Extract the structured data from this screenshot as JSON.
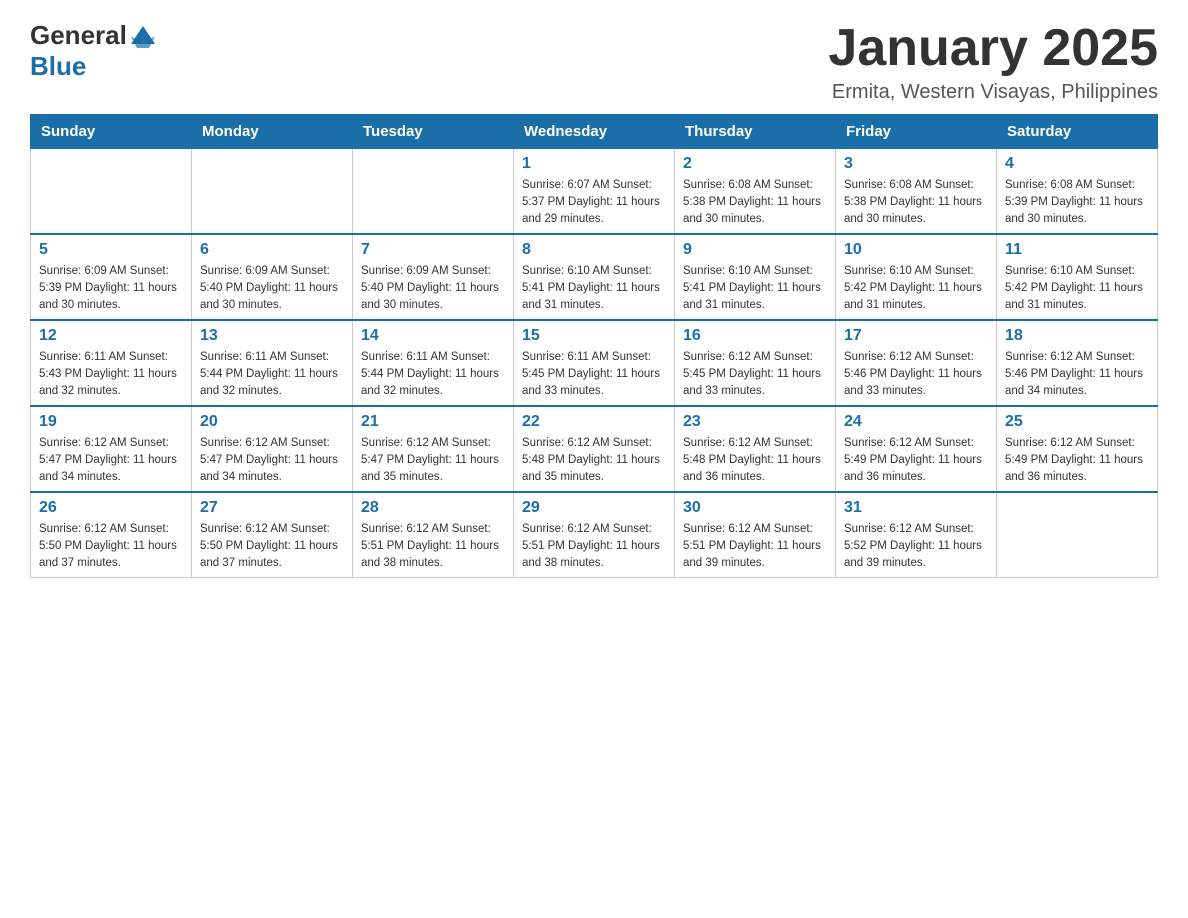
{
  "header": {
    "logo_general": "General",
    "logo_blue": "Blue",
    "month_title": "January 2025",
    "location": "Ermita, Western Visayas, Philippines"
  },
  "days_of_week": [
    "Sunday",
    "Monday",
    "Tuesday",
    "Wednesday",
    "Thursday",
    "Friday",
    "Saturday"
  ],
  "weeks": [
    [
      {
        "day": "",
        "info": ""
      },
      {
        "day": "",
        "info": ""
      },
      {
        "day": "",
        "info": ""
      },
      {
        "day": "1",
        "info": "Sunrise: 6:07 AM\nSunset: 5:37 PM\nDaylight: 11 hours and 29 minutes."
      },
      {
        "day": "2",
        "info": "Sunrise: 6:08 AM\nSunset: 5:38 PM\nDaylight: 11 hours and 30 minutes."
      },
      {
        "day": "3",
        "info": "Sunrise: 6:08 AM\nSunset: 5:38 PM\nDaylight: 11 hours and 30 minutes."
      },
      {
        "day": "4",
        "info": "Sunrise: 6:08 AM\nSunset: 5:39 PM\nDaylight: 11 hours and 30 minutes."
      }
    ],
    [
      {
        "day": "5",
        "info": "Sunrise: 6:09 AM\nSunset: 5:39 PM\nDaylight: 11 hours and 30 minutes."
      },
      {
        "day": "6",
        "info": "Sunrise: 6:09 AM\nSunset: 5:40 PM\nDaylight: 11 hours and 30 minutes."
      },
      {
        "day": "7",
        "info": "Sunrise: 6:09 AM\nSunset: 5:40 PM\nDaylight: 11 hours and 30 minutes."
      },
      {
        "day": "8",
        "info": "Sunrise: 6:10 AM\nSunset: 5:41 PM\nDaylight: 11 hours and 31 minutes."
      },
      {
        "day": "9",
        "info": "Sunrise: 6:10 AM\nSunset: 5:41 PM\nDaylight: 11 hours and 31 minutes."
      },
      {
        "day": "10",
        "info": "Sunrise: 6:10 AM\nSunset: 5:42 PM\nDaylight: 11 hours and 31 minutes."
      },
      {
        "day": "11",
        "info": "Sunrise: 6:10 AM\nSunset: 5:42 PM\nDaylight: 11 hours and 31 minutes."
      }
    ],
    [
      {
        "day": "12",
        "info": "Sunrise: 6:11 AM\nSunset: 5:43 PM\nDaylight: 11 hours and 32 minutes."
      },
      {
        "day": "13",
        "info": "Sunrise: 6:11 AM\nSunset: 5:44 PM\nDaylight: 11 hours and 32 minutes."
      },
      {
        "day": "14",
        "info": "Sunrise: 6:11 AM\nSunset: 5:44 PM\nDaylight: 11 hours and 32 minutes."
      },
      {
        "day": "15",
        "info": "Sunrise: 6:11 AM\nSunset: 5:45 PM\nDaylight: 11 hours and 33 minutes."
      },
      {
        "day": "16",
        "info": "Sunrise: 6:12 AM\nSunset: 5:45 PM\nDaylight: 11 hours and 33 minutes."
      },
      {
        "day": "17",
        "info": "Sunrise: 6:12 AM\nSunset: 5:46 PM\nDaylight: 11 hours and 33 minutes."
      },
      {
        "day": "18",
        "info": "Sunrise: 6:12 AM\nSunset: 5:46 PM\nDaylight: 11 hours and 34 minutes."
      }
    ],
    [
      {
        "day": "19",
        "info": "Sunrise: 6:12 AM\nSunset: 5:47 PM\nDaylight: 11 hours and 34 minutes."
      },
      {
        "day": "20",
        "info": "Sunrise: 6:12 AM\nSunset: 5:47 PM\nDaylight: 11 hours and 34 minutes."
      },
      {
        "day": "21",
        "info": "Sunrise: 6:12 AM\nSunset: 5:47 PM\nDaylight: 11 hours and 35 minutes."
      },
      {
        "day": "22",
        "info": "Sunrise: 6:12 AM\nSunset: 5:48 PM\nDaylight: 11 hours and 35 minutes."
      },
      {
        "day": "23",
        "info": "Sunrise: 6:12 AM\nSunset: 5:48 PM\nDaylight: 11 hours and 36 minutes."
      },
      {
        "day": "24",
        "info": "Sunrise: 6:12 AM\nSunset: 5:49 PM\nDaylight: 11 hours and 36 minutes."
      },
      {
        "day": "25",
        "info": "Sunrise: 6:12 AM\nSunset: 5:49 PM\nDaylight: 11 hours and 36 minutes."
      }
    ],
    [
      {
        "day": "26",
        "info": "Sunrise: 6:12 AM\nSunset: 5:50 PM\nDaylight: 11 hours and 37 minutes."
      },
      {
        "day": "27",
        "info": "Sunrise: 6:12 AM\nSunset: 5:50 PM\nDaylight: 11 hours and 37 minutes."
      },
      {
        "day": "28",
        "info": "Sunrise: 6:12 AM\nSunset: 5:51 PM\nDaylight: 11 hours and 38 minutes."
      },
      {
        "day": "29",
        "info": "Sunrise: 6:12 AM\nSunset: 5:51 PM\nDaylight: 11 hours and 38 minutes."
      },
      {
        "day": "30",
        "info": "Sunrise: 6:12 AM\nSunset: 5:51 PM\nDaylight: 11 hours and 39 minutes."
      },
      {
        "day": "31",
        "info": "Sunrise: 6:12 AM\nSunset: 5:52 PM\nDaylight: 11 hours and 39 minutes."
      },
      {
        "day": "",
        "info": ""
      }
    ]
  ]
}
